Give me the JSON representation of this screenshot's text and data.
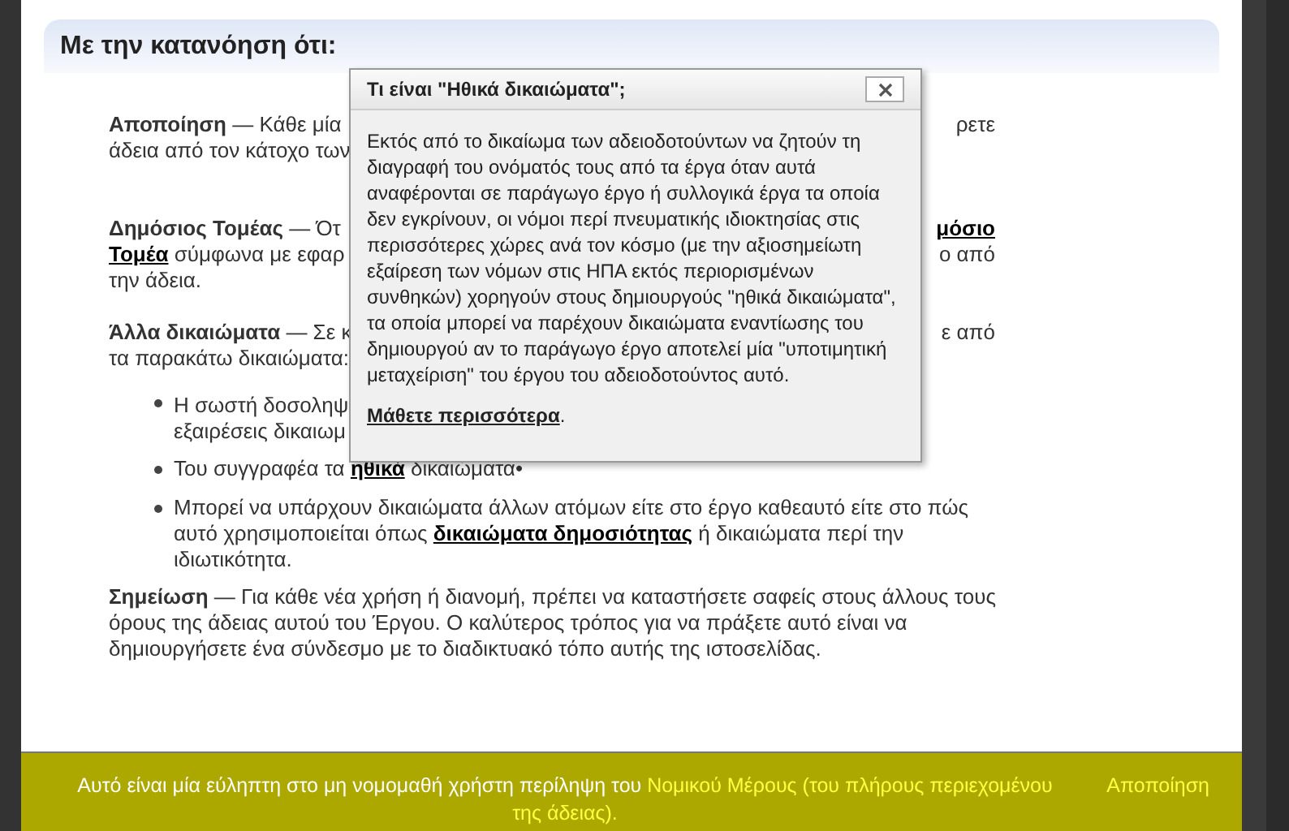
{
  "header": {
    "title": "Με την κατανόηση ότι:"
  },
  "sections": [
    {
      "kind": "paragraph",
      "lines": [
        {
          "left": [
            {
              "kind": "term",
              "text": "Αποποίηση"
            },
            {
              "kind": "text",
              "text": " — Κάθε μία"
            }
          ],
          "right": [
            {
              "kind": "text",
              "text": "ρετε"
            }
          ]
        },
        {
          "left": [
            {
              "kind": "text",
              "text": "άδεια από τον κάτοχο των"
            }
          ]
        }
      ]
    },
    {
      "kind": "paragraph",
      "lines": [
        {
          "left": [
            {
              "kind": "term",
              "text": "Δημόσιος Τομέας"
            },
            {
              "kind": "text",
              "text": " — Ότ"
            }
          ],
          "right": [
            {
              "kind": "link",
              "text": "μόσιο"
            }
          ]
        },
        {
          "left": [
            {
              "kind": "link",
              "text": "Τομέα"
            },
            {
              "kind": "text",
              "text": " σύμφωνα με εφαρ"
            }
          ],
          "right": [
            {
              "kind": "text",
              "text": "ο από"
            }
          ]
        },
        {
          "left": [
            {
              "kind": "text",
              "text": "την άδεια."
            }
          ]
        }
      ]
    },
    {
      "kind": "paragraph",
      "lines": [
        {
          "left": [
            {
              "kind": "term",
              "text": "Άλλα δικαιώματα"
            },
            {
              "kind": "text",
              "text": " — Σε κ"
            }
          ],
          "right": [
            {
              "kind": "text",
              "text": "ε από"
            }
          ]
        },
        {
          "left": [
            {
              "kind": "text",
              "text": "τα παρακάτω δικαιώματα:"
            }
          ]
        }
      ]
    },
    {
      "kind": "bullet",
      "lines": [
        {
          "left": [
            {
              "kind": "text",
              "text": "Η σωστή δοσοληψ"
            }
          ]
        },
        {
          "left": [
            {
              "kind": "text",
              "text": "εξαιρέσεις δικαιωμ"
            }
          ]
        }
      ]
    },
    {
      "kind": "bullet",
      "segments": [
        {
          "kind": "text",
          "text": "Του συγγραφέα τα "
        },
        {
          "kind": "link",
          "text": "ηθικά"
        },
        {
          "kind": "text",
          "text": " δικαιώματα•"
        }
      ]
    },
    {
      "kind": "bullet",
      "segments": [
        {
          "kind": "text",
          "text": "Μπορεί να υπάρχουν δικαιώματα άλλων ατόμων είτε στο έργο καθεαυτό είτε στο πώς αυτό χρησιμοποιείται όπως "
        },
        {
          "kind": "link",
          "text": "δικαιώματα δημοσιότητας"
        },
        {
          "kind": "text",
          "text": " ή δικαιώματα περί την ιδιωτικότητα."
        }
      ]
    },
    {
      "kind": "paragraph",
      "segments": [
        {
          "kind": "term",
          "text": "Σημείωση"
        },
        {
          "kind": "text",
          "text": " — Για κάθε νέα χρήση ή διανομή, πρέπει να καταστήσετε σαφείς στους άλλους τους όρους της άδειας αυτού του Έργου. Ο καλύτερος τρόπος για να πράξετε αυτό είναι να δημιουργήσετε ένα σύνδεσμο με το διαδικτυακό τόπο αυτής της ιστοσελίδας."
        }
      ]
    }
  ],
  "popup": {
    "title": "Τι είναι \"Ηθικά δικαιώματα\";",
    "body": "Εκτός από το δικαίωμα των αδειοδοτούντων να ζητούν τη διαγραφή του ονόματός τους από τα έργα όταν αυτά αναφέρονται σε παράγωγο έργο ή συλλογικά έργα τα οποία δεν εγκρίνουν, οι νόμοι περί πνευματικής ιδιοκτησίας στις περισσότερες χώρες ανά τον κόσμο (με την αξιοσημείωτη εξαίρεση των νόμων στις ΗΠΑ εκτός περιορισμένων συνθηκών) χορηγούν στους δημιουργούς \"ηθικά δικαιώματα\", τα οποία μπορεί να παρέχουν δικαιώματα εναντίωσης του δημιουργού αν το παράγωγο έργο αποτελεί μία \"υποτιμητική μεταχείριση\" του έργου του αδειοδοτούντος αυτό.",
    "link": "Μάθετε περισσότερα",
    "after_link": "."
  },
  "footer": {
    "text": "Αυτό είναι μία εύληπτη στο μη νομομαθή χρήστη περίληψη του ",
    "link_lines": [
      "Νομικού Μέρους (του πλήρους περιεχομένου",
      "της άδειας)."
    ],
    "side_link": "Αποποίηση"
  }
}
